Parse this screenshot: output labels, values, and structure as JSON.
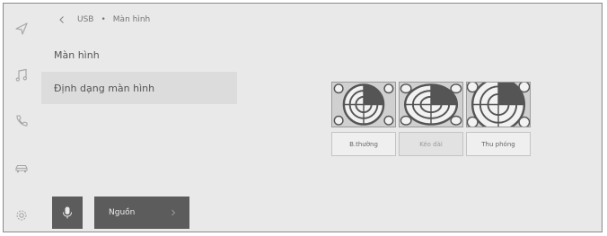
{
  "breadcrumb": {
    "parent": "USB",
    "separator": "•",
    "current": "Màn hình"
  },
  "menu": {
    "items": [
      {
        "label": "Màn hình",
        "selected": false
      },
      {
        "label": "Định dạng màn hình",
        "selected": true
      }
    ]
  },
  "display_format": {
    "options": [
      {
        "label": "B.thường",
        "selected": false
      },
      {
        "label": "Kéo dài",
        "selected": true
      },
      {
        "label": "Thu phóng",
        "selected": false
      }
    ]
  },
  "bottom_bar": {
    "source_label": "Nguồn"
  },
  "side_nav": {
    "icons": [
      "navigation-icon",
      "music-icon",
      "phone-icon",
      "car-icon",
      "settings-icon"
    ]
  },
  "colors": {
    "background": "#e9e9e9",
    "selected_row": "#dcdcdc",
    "dark_button": "#5c5c5c"
  }
}
